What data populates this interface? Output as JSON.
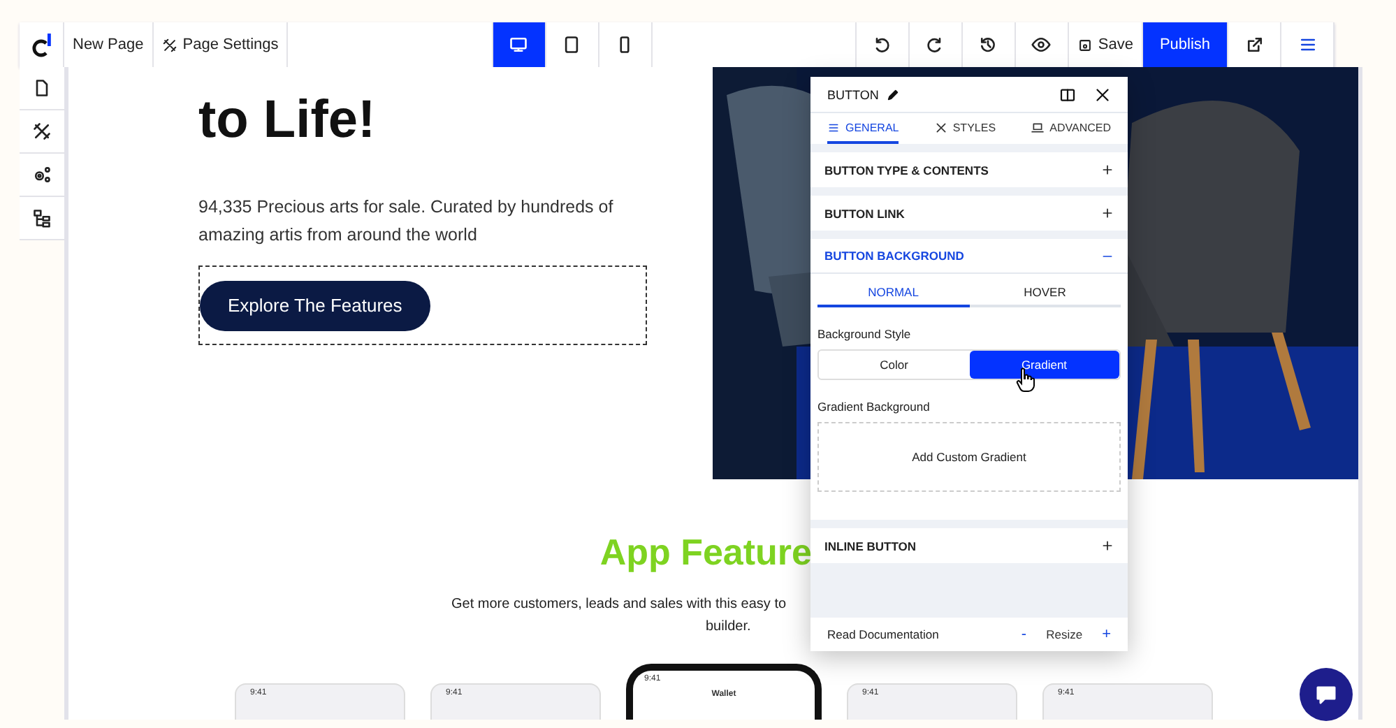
{
  "toolbar": {
    "page_name": "New Page",
    "page_settings": "Page Settings",
    "devices": [
      {
        "kind": "desktop",
        "selected": true
      },
      {
        "kind": "tablet",
        "selected": false
      },
      {
        "kind": "mobile",
        "selected": false
      }
    ],
    "save": "Save",
    "publish": "Publish"
  },
  "canvas": {
    "hero": {
      "heading": "to Life!",
      "text": "94,335 Precious arts for sale. Curated by hundreds of amazing artis from around the world",
      "button": "Explore The Features"
    },
    "features": {
      "heading": "App Feature",
      "subtitle_lines": [
        "Get more customers, leads and sales with this easy to",
        "builder."
      ]
    },
    "phones": [
      {
        "time": "9:41"
      },
      {
        "time": "9:41"
      },
      {
        "time": "9:41",
        "title": "Wallet",
        "kind": "main"
      },
      {
        "time": "9:41"
      },
      {
        "time": "9:41"
      }
    ]
  },
  "panel": {
    "title": "BUTTON",
    "tabs": [
      {
        "label": "GENERAL",
        "kind": "general",
        "selected": true
      },
      {
        "label": "STYLES",
        "kind": "styles",
        "selected": false
      },
      {
        "label": "ADVANCED",
        "kind": "advanced",
        "selected": false
      }
    ],
    "sections": [
      {
        "title": "BUTTON TYPE & CONTENTS",
        "expanded": false
      },
      {
        "title": "BUTTON LINK",
        "expanded": false
      },
      {
        "title": "BUTTON BACKGROUND",
        "expanded": true,
        "states": [
          {
            "label": "NORMAL",
            "selected": true
          },
          {
            "label": "HOVER",
            "selected": false
          }
        ],
        "style_label": "Background Style",
        "styles": [
          {
            "label": "Color",
            "selected": false
          },
          {
            "label": "Gradient",
            "selected": true
          }
        ],
        "gradient_label": "Gradient Background",
        "add_gradient": "Add Custom Gradient"
      },
      {
        "title": "INLINE BUTTON",
        "expanded": false
      }
    ],
    "footer": {
      "docs": "Read Documentation",
      "minus": "-",
      "resize": "Resize",
      "plus": "+"
    }
  }
}
